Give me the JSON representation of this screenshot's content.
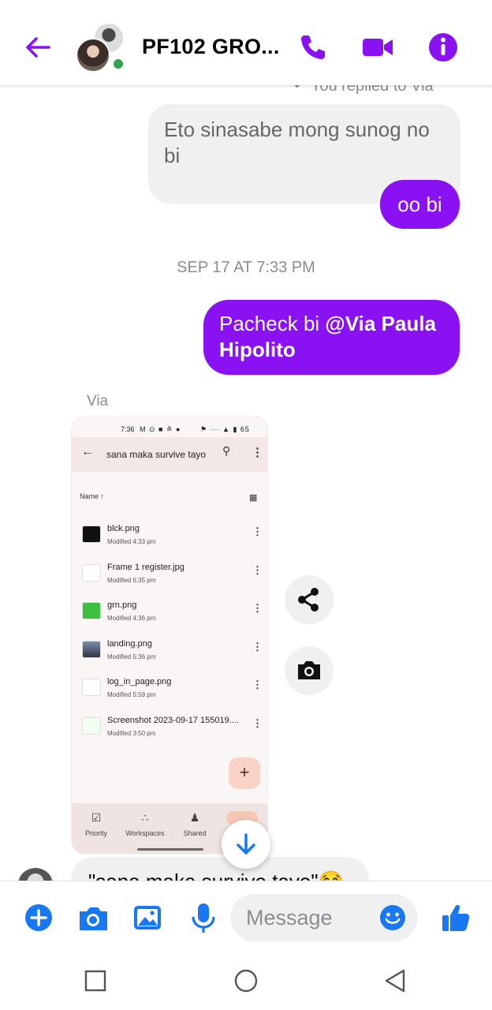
{
  "header": {
    "title": "PF102 GRO...",
    "colors": {
      "accent": "#8a12f2",
      "online": "#31a24c"
    }
  },
  "messages": {
    "reply_label": "You replied to Via",
    "quoted_text": "Eto sinasabe mong sunog no bi",
    "reply_text": "oo bi",
    "timestamp": "SEP 17 AT 7:33 PM",
    "sent_text": "Pacheck bi ",
    "sent_mention": "@Via Paula Hipolito",
    "sender_name": "Via",
    "partial_text": "\"sana maka survive tayo\"😂"
  },
  "shared_image": {
    "status_time": "7:36",
    "status_icons": "M ⊙ ■ ≙ ●",
    "status_right": "⚑ ··· ▲ ▮ 65",
    "folder_title": "sana maka survive tayo",
    "sort_label": "Name ↑",
    "files": [
      {
        "name": "blck.png",
        "meta": "Modified 4:33 pm"
      },
      {
        "name": "Frame 1 register.jpg",
        "meta": "Modified 6:35 pm"
      },
      {
        "name": "grn.png",
        "meta": "Modified 4:36 pm"
      },
      {
        "name": "landing.png",
        "meta": "Modified 5:36 pm"
      },
      {
        "name": "log_in_page.png",
        "meta": "Modified 5:59 pm"
      },
      {
        "name": "Screenshot 2023-09-17 155019....",
        "meta": "Modified 3:50 pm"
      }
    ],
    "fab_label": "+",
    "nav": [
      {
        "label": "Priority",
        "icon": "☑"
      },
      {
        "label": "Workspaces",
        "icon": "∴"
      },
      {
        "label": "Shared",
        "icon": "♟"
      }
    ]
  },
  "composer": {
    "placeholder": "Message",
    "icons": [
      "plus-icon",
      "camera-icon",
      "gallery-icon",
      "microphone-icon",
      "emoji-icon",
      "like-icon"
    ]
  }
}
